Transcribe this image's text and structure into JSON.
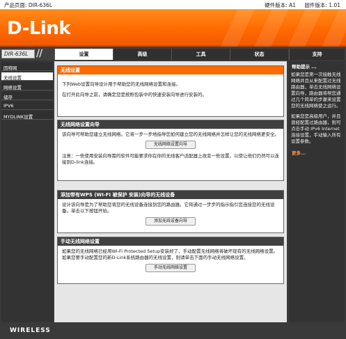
{
  "topbar": {
    "product_page": "产品页面: DIR-636L",
    "hw_version": "硬件版本: A1",
    "fw_version": "固件版本: 1.01"
  },
  "brand": {
    "logo": "D-Link"
  },
  "nav": {
    "model": "DIR-636L",
    "tabs": [
      {
        "label": "设置",
        "active": true
      },
      {
        "label": "高级",
        "active": false
      },
      {
        "label": "工具",
        "active": false
      },
      {
        "label": "状态",
        "active": false
      },
      {
        "label": "支持",
        "active": false
      }
    ]
  },
  "sidebar": {
    "items": [
      {
        "label": "因特网",
        "active": false
      },
      {
        "label": "无线设置",
        "active": true
      },
      {
        "label": "网络设置",
        "active": false
      },
      {
        "label": "储存",
        "active": false
      },
      {
        "label": "IPV6",
        "active": false
      },
      {
        "label": "MYDLINK设置",
        "active": false
      }
    ]
  },
  "main": {
    "intro": {
      "title": "无线设置",
      "p1": "下列Web设置向导设计用于帮助您的无线网络设置和连接。",
      "p2": "在打开此向导之前，请确定您是按照包装中的快速安装向导进行安装的。"
    },
    "wizard": {
      "title": "无线网络设置向导",
      "text": "该向导可帮助您建立无线网络。它将一步一步地指导您如何建立您的无线网络并怎样让您的无线网络更安全。",
      "button": "无线网络设置向导",
      "note": "注意：一些使用安装向导需的软件可能要求你在你的无线客户适配器上改变一些设置，以使让他们仍然可以连接到D-link连接。"
    },
    "wps": {
      "title": "添加带有WPS (WI-FI 被保护 安装)向导的无线设备",
      "text": "设计该向导是为了帮助您将您的无线设备连接到您的路由器。它将通过一步步的指示指引您连接您的无线设备。单击以下按钮开始。",
      "button": "添加无线设备向导"
    },
    "manual": {
      "title": "手动无线网络设置",
      "text": "如果您的无线网络已经用Wi-Fi Protected Setup安装好了，手动配置无线网络将破坏现有的无线网络设置。如果您要手动配置您的新D-Link系统路由器的无线设置，则请单击下面的手动无线网络设置。",
      "button": "手动无线网络设置"
    }
  },
  "help": {
    "title": "帮助提示 ...",
    "p1": "如果您是第一次接触无线网络并且从来配置过无线路由器，单击无线网络设置向导，路由器将帮您通过几个简单的步骤来设置您的无线网络使之运行。",
    "p2": "如果您是高级用户，并且曾经配置过路由器，则可点击手动 IPv6 Internet 连接设置，手动输入所有设置参数。",
    "more": "更多..."
  },
  "footer": {
    "wireless": "WIRELESS"
  },
  "colors": {
    "accent": "#ff6a00",
    "dark": "#404040"
  }
}
